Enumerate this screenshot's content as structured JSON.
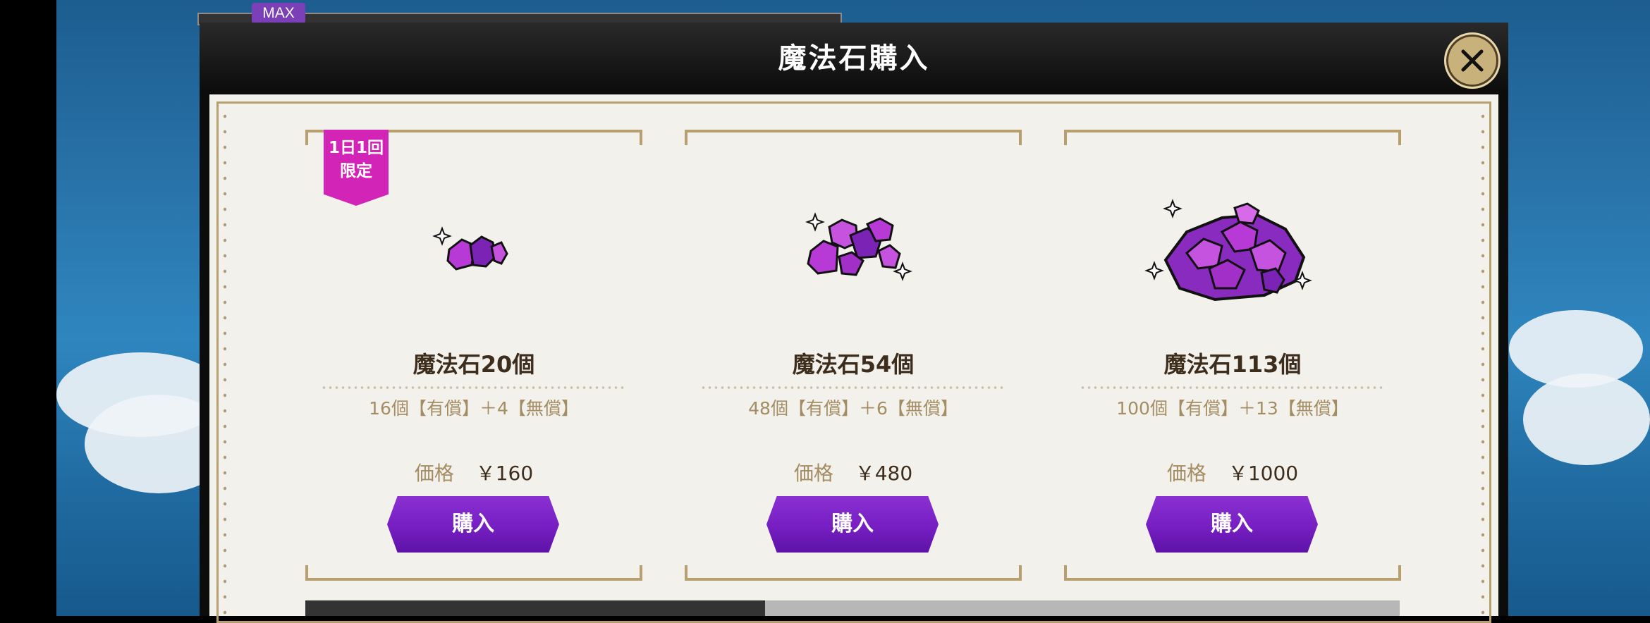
{
  "background": {
    "badge": "MAX"
  },
  "modal": {
    "title": "魔法石購入"
  },
  "cards": [
    {
      "ribbon_line1": "1日1回",
      "ribbon_line2": "限定",
      "name": "魔法石20個",
      "desc": "16個【有償】＋4【無償】",
      "price_label": "価格",
      "price": "￥160",
      "buy_label": "購入"
    },
    {
      "name": "魔法石54個",
      "desc": "48個【有償】＋6【無償】",
      "price_label": "価格",
      "price": "￥480",
      "buy_label": "購入"
    },
    {
      "name": "魔法石113個",
      "desc": "100個【有償】＋13【無償】",
      "price_label": "価格",
      "price": "￥1000",
      "buy_label": "購入"
    }
  ],
  "colors": {
    "accent": "#7820c4",
    "gold": "#b79f6e",
    "ribbon": "#d324b8"
  },
  "icons": {
    "close": "close-icon",
    "gem": "magic-stone-icon"
  }
}
